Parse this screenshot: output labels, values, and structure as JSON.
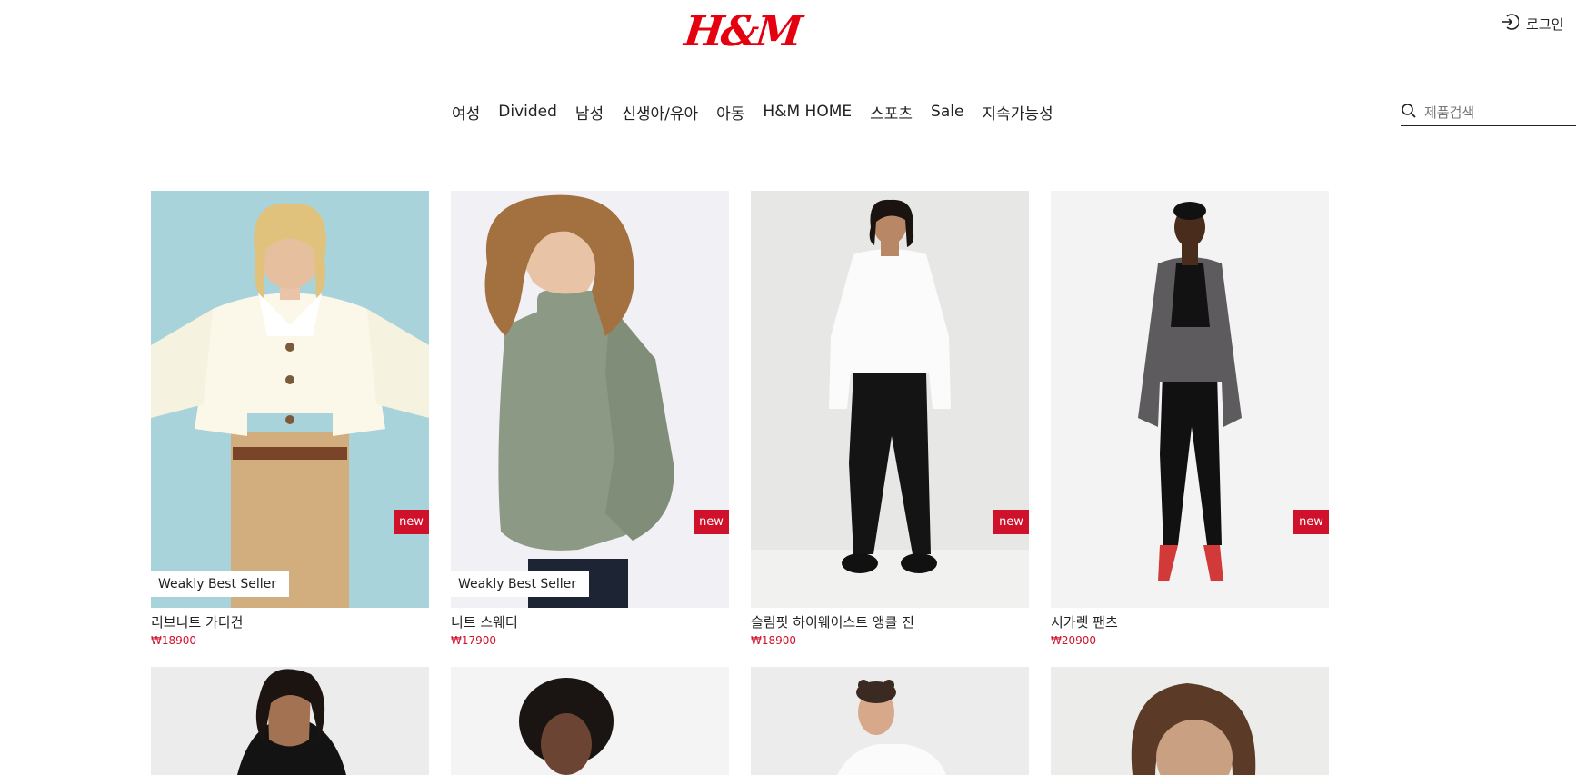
{
  "brand": {
    "logo_text": "H&M",
    "logo_color": "#e50010"
  },
  "header": {
    "login_label": "로그인",
    "login_icon": "login-icon"
  },
  "nav": {
    "items": [
      "여성",
      "Divided",
      "남성",
      "신생아/유아",
      "아동",
      "H&M HOME",
      "스포츠",
      "Sale",
      "지속가능성"
    ]
  },
  "search": {
    "placeholder": "제품검색",
    "value": "",
    "icon": "search-icon"
  },
  "accent_color": "#d0112b",
  "products": [
    {
      "name": "리브니트 가디건",
      "price": "₩18900",
      "badge": "new",
      "tag": "Weakly Best Seller",
      "background": "#a9d3da",
      "image": "woman-cream-cardigan-photo"
    },
    {
      "name": "니트 스웨터",
      "price": "₩17900",
      "badge": "new",
      "tag": "Weakly Best Seller",
      "background": "#f1f0f4",
      "image": "woman-green-knit-sweater-photo"
    },
    {
      "name": "슬림핏 하이웨이스트 앵클 진",
      "price": "₩18900",
      "badge": "new",
      "tag": "",
      "background": "#e7e7e5",
      "image": "woman-white-shirt-black-jeans-photo"
    },
    {
      "name": "시가렛 팬츠",
      "price": "₩20900",
      "badge": "new",
      "tag": "",
      "background": "#f3f3f3",
      "image": "woman-grey-blazer-black-pants-photo"
    },
    {
      "name": "",
      "price": "",
      "badge": "",
      "tag": "",
      "background": "#ececec",
      "image": "woman-black-hoodie-photo"
    },
    {
      "name": "",
      "price": "",
      "badge": "",
      "tag": "",
      "background": "#f4f4f4",
      "image": "woman-curly-hair-photo"
    },
    {
      "name": "",
      "price": "",
      "badge": "",
      "tag": "",
      "background": "#ececec",
      "image": "woman-white-shirt-photo"
    },
    {
      "name": "",
      "price": "",
      "badge": "",
      "tag": "",
      "background": "#ececea",
      "image": "woman-portrait-photo"
    }
  ]
}
